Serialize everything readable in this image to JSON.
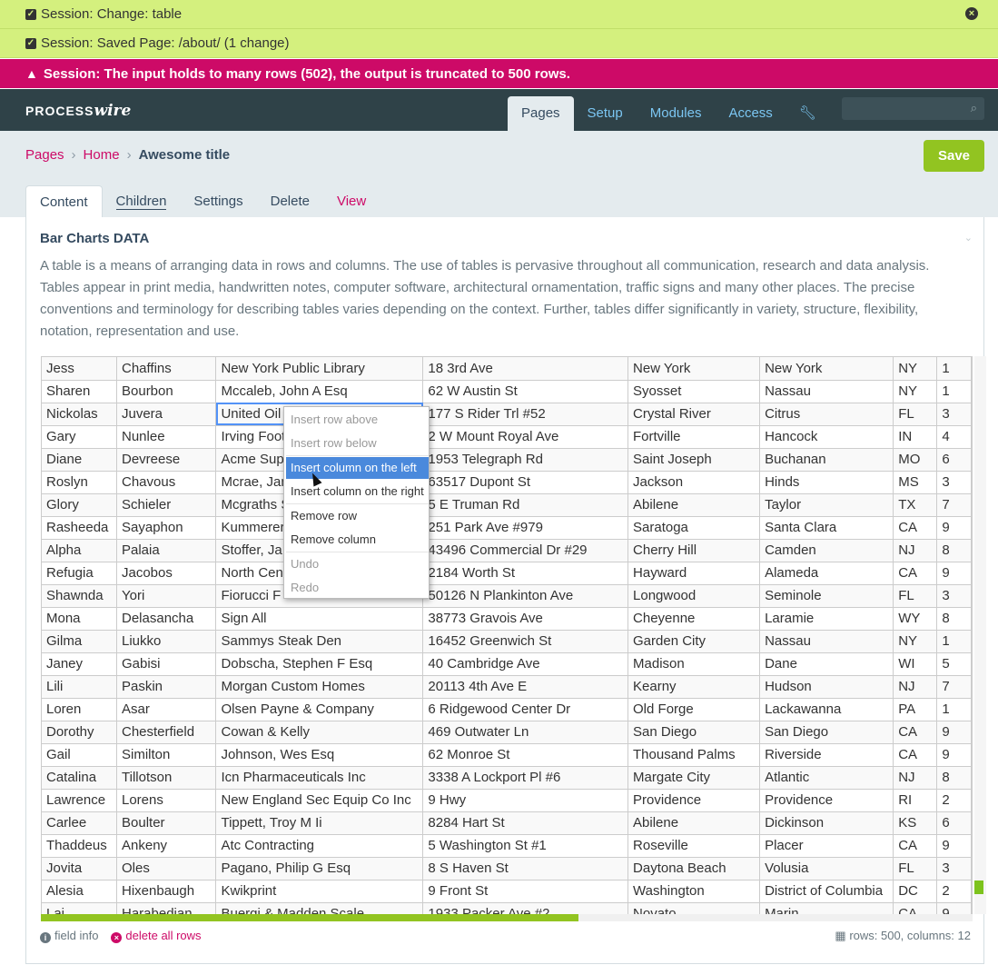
{
  "notices": [
    {
      "text": "Session: Change: table",
      "type": "ok"
    },
    {
      "text": "Session: Saved Page: /about/ (1 change)",
      "type": "ok"
    },
    {
      "text": "Session: The input holds to many rows (502), the output is truncated to 500 rows.",
      "type": "error"
    }
  ],
  "brand": {
    "left": "PROCESS",
    "right": "wire"
  },
  "topnav": [
    "Pages",
    "Setup",
    "Modules",
    "Access"
  ],
  "breadcrumb": [
    "Pages",
    "Home"
  ],
  "page_title": "Awesome title",
  "save_label": "Save",
  "tabs": [
    "Content",
    "Children",
    "Settings",
    "Delete",
    "View"
  ],
  "field": {
    "label": "Bar Charts DATA",
    "description": "A table is a means of arranging data in rows and columns. The use of tables is pervasive throughout all communication, research and data analysis. Tables appear in print media, handwritten notes, computer software, architectural ornamentation, traffic signs and many other places. The precise conventions and terminology for describing tables varies depending on the context. Further, tables differ significantly in variety, structure, flexibility, notation, representation and use.",
    "info_label": "field info",
    "delete_label": "delete all rows",
    "stats": "rows: 500, columns: 12",
    "scroll": {
      "horizontal_position": 0.58,
      "vertical_position": 0.94
    }
  },
  "context_menu": [
    "Insert row above",
    "Insert row below",
    "Insert column on the left",
    "Insert column on the right",
    "Remove row",
    "Remove column",
    "Undo",
    "Redo"
  ],
  "rows": [
    [
      "Jess",
      "Chaffins",
      "New York Public Library",
      "18 3rd Ave",
      "New York",
      "New York",
      "NY",
      "1"
    ],
    [
      "Sharen",
      "Bourbon",
      "Mccaleb, John A Esq",
      "62 W Austin St",
      "Syosset",
      "Nassau",
      "NY",
      "1"
    ],
    [
      "Nickolas",
      "Juvera",
      "United Oil",
      "177 S Rider Trl #52",
      "Crystal River",
      "Citrus",
      "FL",
      "3"
    ],
    [
      "Gary",
      "Nunlee",
      "Irving Foot",
      "2 W Mount Royal Ave",
      "Fortville",
      "Hancock",
      "IN",
      "4"
    ],
    [
      "Diane",
      "Devreese",
      "Acme Sup",
      "1953 Telegraph Rd",
      "Saint Joseph",
      "Buchanan",
      "MO",
      "6"
    ],
    [
      "Roslyn",
      "Chavous",
      "Mcrae, Jan",
      "63517 Dupont St",
      "Jackson",
      "Hinds",
      "MS",
      "3"
    ],
    [
      "Glory",
      "Schieler",
      "Mcgraths S",
      "5 E Truman Rd",
      "Abilene",
      "Taylor",
      "TX",
      "7"
    ],
    [
      "Rasheeda",
      "Sayaphon",
      "Kummerer",
      "251 Park Ave #979",
      "Saratoga",
      "Santa Clara",
      "CA",
      "9"
    ],
    [
      "Alpha",
      "Palaia",
      "Stoffer, Ja",
      "43496 Commercial Dr #29",
      "Cherry Hill",
      "Camden",
      "NJ",
      "8"
    ],
    [
      "Refugia",
      "Jacobos",
      "North Cen",
      "2184 Worth St",
      "Hayward",
      "Alameda",
      "CA",
      "9"
    ],
    [
      "Shawnda",
      "Yori",
      "Fiorucci F",
      "50126 N Plankinton Ave",
      "Longwood",
      "Seminole",
      "FL",
      "3"
    ],
    [
      "Mona",
      "Delasancha",
      "Sign All",
      "38773 Gravois Ave",
      "Cheyenne",
      "Laramie",
      "WY",
      "8"
    ],
    [
      "Gilma",
      "Liukko",
      "Sammys Steak Den",
      "16452 Greenwich St",
      "Garden City",
      "Nassau",
      "NY",
      "1"
    ],
    [
      "Janey",
      "Gabisi",
      "Dobscha, Stephen F Esq",
      "40 Cambridge Ave",
      "Madison",
      "Dane",
      "WI",
      "5"
    ],
    [
      "Lili",
      "Paskin",
      "Morgan Custom Homes",
      "20113 4th Ave E",
      "Kearny",
      "Hudson",
      "NJ",
      "7"
    ],
    [
      "Loren",
      "Asar",
      "Olsen Payne & Company",
      "6 Ridgewood Center Dr",
      "Old Forge",
      "Lackawanna",
      "PA",
      "1"
    ],
    [
      "Dorothy",
      "Chesterfield",
      "Cowan & Kelly",
      "469 Outwater Ln",
      "San Diego",
      "San Diego",
      "CA",
      "9"
    ],
    [
      "Gail",
      "Similton",
      "Johnson, Wes Esq",
      "62 Monroe St",
      "Thousand Palms",
      "Riverside",
      "CA",
      "9"
    ],
    [
      "Catalina",
      "Tillotson",
      "Icn Pharmaceuticals Inc",
      "3338 A Lockport Pl #6",
      "Margate City",
      "Atlantic",
      "NJ",
      "8"
    ],
    [
      "Lawrence",
      "Lorens",
      "New England Sec Equip Co Inc",
      "9 Hwy",
      "Providence",
      "Providence",
      "RI",
      "2"
    ],
    [
      "Carlee",
      "Boulter",
      "Tippett, Troy M Ii",
      "8284 Hart St",
      "Abilene",
      "Dickinson",
      "KS",
      "6"
    ],
    [
      "Thaddeus",
      "Ankeny",
      "Atc Contracting",
      "5 Washington St #1",
      "Roseville",
      "Placer",
      "CA",
      "9"
    ],
    [
      "Jovita",
      "Oles",
      "Pagano, Philip G Esq",
      "8 S Haven St",
      "Daytona Beach",
      "Volusia",
      "FL",
      "3"
    ],
    [
      "Alesia",
      "Hixenbaugh",
      "Kwikprint",
      "9 Front St",
      "Washington",
      "District of Columbia",
      "DC",
      "2"
    ],
    [
      "Lai",
      "Harabedian",
      "Buergi & Madden Scale",
      "1933 Packer Ave #2",
      "Novato",
      "Marin",
      "CA",
      "9"
    ]
  ]
}
